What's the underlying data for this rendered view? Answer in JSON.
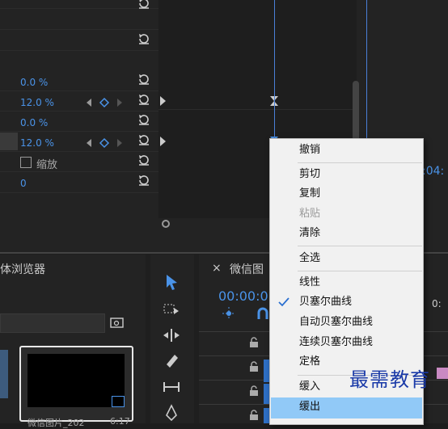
{
  "effect_controls": {
    "values": [
      "0.0 %",
      "12.0 %",
      "0.0 %",
      "12.0 %"
    ],
    "scale_label": "缩放",
    "zero_value": "0",
    "timecode_partial": ":04:"
  },
  "project_panel": {
    "title_partial": "体浏览器",
    "thumb_label": "微信图片_202",
    "thumb_duration": "6:17"
  },
  "timeline": {
    "tab_close": "×",
    "tab_title": "微信图",
    "timecode": "00:00:0",
    "right_partial": "0:"
  },
  "context_menu": {
    "items": [
      {
        "label": "撤销",
        "enabled": true
      },
      {
        "label": "剪切",
        "enabled": true
      },
      {
        "label": "复制",
        "enabled": true
      },
      {
        "label": "粘贴",
        "enabled": false
      },
      {
        "label": "清除",
        "enabled": true
      },
      {
        "label": "全选",
        "enabled": true
      },
      {
        "label": "线性",
        "enabled": true
      },
      {
        "label": "贝塞尔曲线",
        "enabled": true,
        "checked": true
      },
      {
        "label": "自动贝塞尔曲线",
        "enabled": true
      },
      {
        "label": "连续贝塞尔曲线",
        "enabled": true
      },
      {
        "label": "定格",
        "enabled": true
      },
      {
        "label": "缓入",
        "enabled": true
      },
      {
        "label": "缓出",
        "enabled": true,
        "highlighted": true
      }
    ]
  },
  "watermark": "最需教育",
  "colors": {
    "accent": "#4a93e8",
    "menu_bg": "#f1f1f1",
    "highlight": "#91c9f7"
  }
}
